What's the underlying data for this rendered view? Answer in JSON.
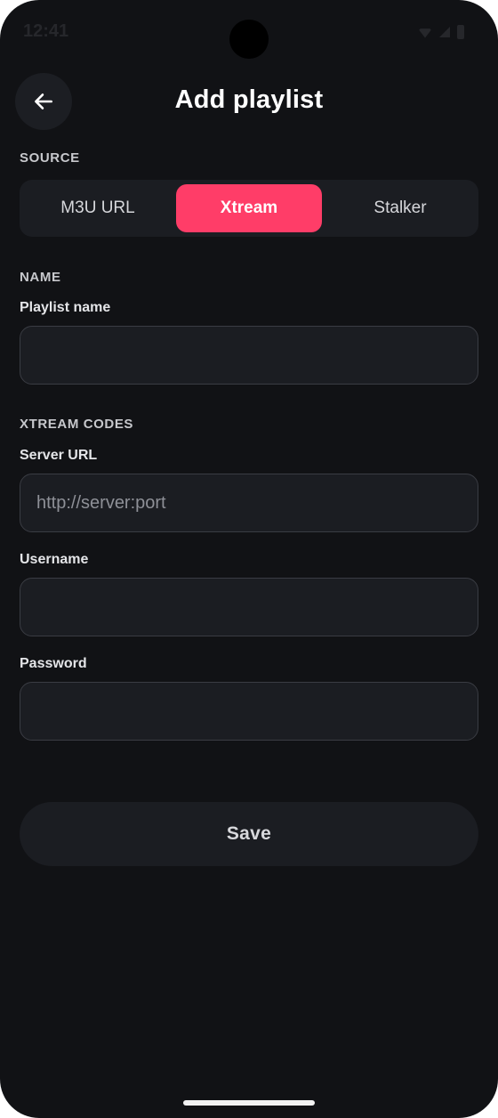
{
  "status_bar": {
    "time": "12:41"
  },
  "header": {
    "back_icon": "arrow-left-icon",
    "title": "Add playlist"
  },
  "source": {
    "section_label": "SOURCE",
    "options": [
      "M3U URL",
      "Xtream",
      "Stalker"
    ],
    "selected": "Xtream",
    "accent_color": "#ff3d68"
  },
  "name_section": {
    "section_label": "NAME",
    "playlist_name": {
      "label": "Playlist name",
      "value": "",
      "placeholder": ""
    }
  },
  "xtream_section": {
    "section_label": "XTREAM CODES",
    "server_url": {
      "label": "Server URL",
      "value": "",
      "placeholder": "http://server:port"
    },
    "username": {
      "label": "Username",
      "value": "",
      "placeholder": ""
    },
    "password": {
      "label": "Password",
      "value": "",
      "placeholder": ""
    }
  },
  "actions": {
    "save_label": "Save"
  }
}
